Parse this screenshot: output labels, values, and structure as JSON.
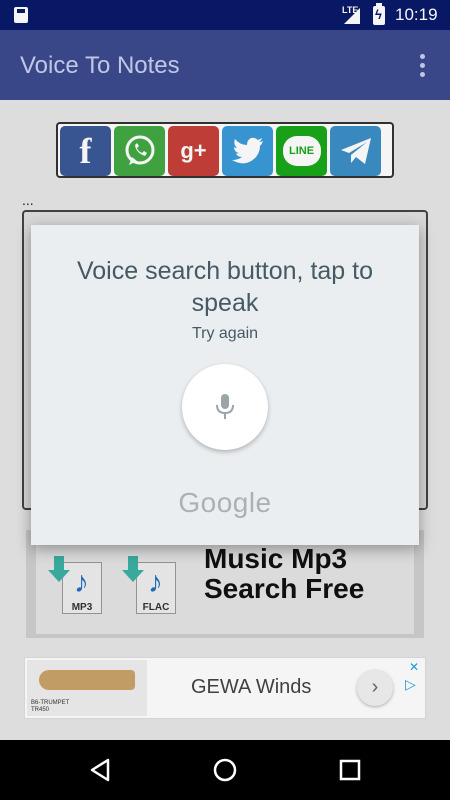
{
  "status_bar": {
    "network": "LTE",
    "time": "10:19"
  },
  "app_bar": {
    "title": "Voice To Notes"
  },
  "share_buttons": [
    {
      "icon": "facebook-icon",
      "glyph": "f"
    },
    {
      "icon": "whatsapp-icon"
    },
    {
      "icon": "google-plus-icon",
      "glyph": "g+"
    },
    {
      "icon": "twitter-icon"
    },
    {
      "icon": "line-icon",
      "glyph": "LINE"
    },
    {
      "icon": "telegram-icon"
    }
  ],
  "notes": {
    "ellipsis": "..."
  },
  "ad_banner": {
    "title_line1": "Music Mp3",
    "title_line2": "Search Free",
    "file_types": [
      "MP3",
      "FLAC"
    ]
  },
  "ad_small": {
    "label": "GEWA Winds",
    "caption_line1": "B6-TRUMPET",
    "caption_line2": "TR450"
  },
  "voice_dialog": {
    "prompt": "Voice search button, tap to speak",
    "status": "Try again",
    "brand": "Google"
  },
  "colors": {
    "status_bar": "#0a1a6a",
    "app_bar": "#3c4a8e",
    "dialog_bg": "#ebeef0",
    "dialog_text": "#455a64"
  }
}
